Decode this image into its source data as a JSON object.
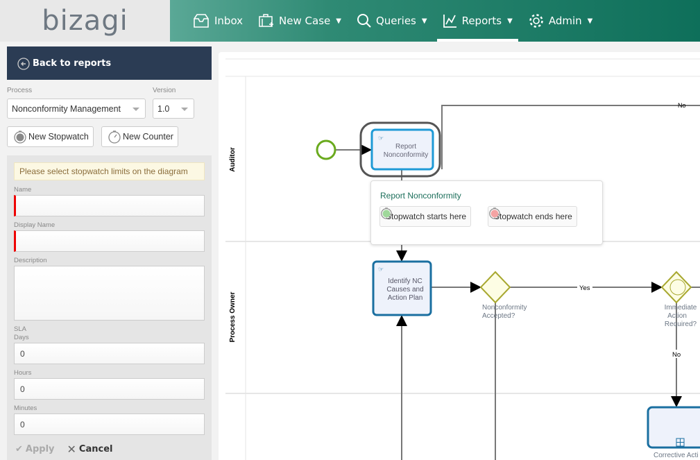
{
  "header": {
    "logo": "bizagi",
    "nav": [
      {
        "label": "Inbox",
        "icon": "inbox-icon"
      },
      {
        "label": "New Case",
        "icon": "briefcase-plus-icon"
      },
      {
        "label": "Queries",
        "icon": "search-icon"
      },
      {
        "label": "Reports",
        "icon": "chart-icon",
        "active": true
      },
      {
        "label": "Admin",
        "icon": "gear-icon"
      }
    ]
  },
  "sidebar": {
    "back_label": "Back to reports",
    "process_label": "Process",
    "process_value": "Nonconformity Management",
    "version_label": "Version",
    "version_value": "1.0",
    "new_stopwatch": "New Stopwatch",
    "new_counter": "New Counter",
    "warning": "Please select stopwatch limits on the diagram",
    "name_label": "Name",
    "name_value": "",
    "display_name_label": "Display Name",
    "display_name_value": "",
    "description_label": "Description",
    "description_value": "",
    "sla_label": "SLA",
    "days_label": "Days",
    "days_value": "0",
    "hours_label": "Hours",
    "hours_value": "0",
    "minutes_label": "Minutes",
    "minutes_value": "0",
    "apply": "Apply",
    "cancel": "Cancel"
  },
  "diagram": {
    "lanes": [
      "Auditor",
      "Process Owner"
    ],
    "tasks": {
      "report": [
        "Report",
        "Nonconformity"
      ],
      "identify": [
        "Identify NC",
        "Causes and",
        "Action Plan"
      ],
      "corrective": "Corrective Acti"
    },
    "gateways": {
      "accepted": [
        "Nonconformity",
        "Accepted?"
      ],
      "immediate": [
        "Immediate",
        "Action",
        "Required?"
      ]
    },
    "flow_labels": {
      "no_top": "No",
      "yes": "Yes",
      "no_down": "No"
    },
    "popup": {
      "title": "Report Nonconformity",
      "start": "Stopwatch starts here",
      "end": "Stopwatch ends here"
    }
  },
  "colors": {
    "nav": "#0e6f5a",
    "back": "#2b3c54",
    "task_border": "#1a6fa0",
    "selected_task": "#1e9ad6",
    "gateway": "#a8a830",
    "start_event": "#6aaa1e"
  }
}
